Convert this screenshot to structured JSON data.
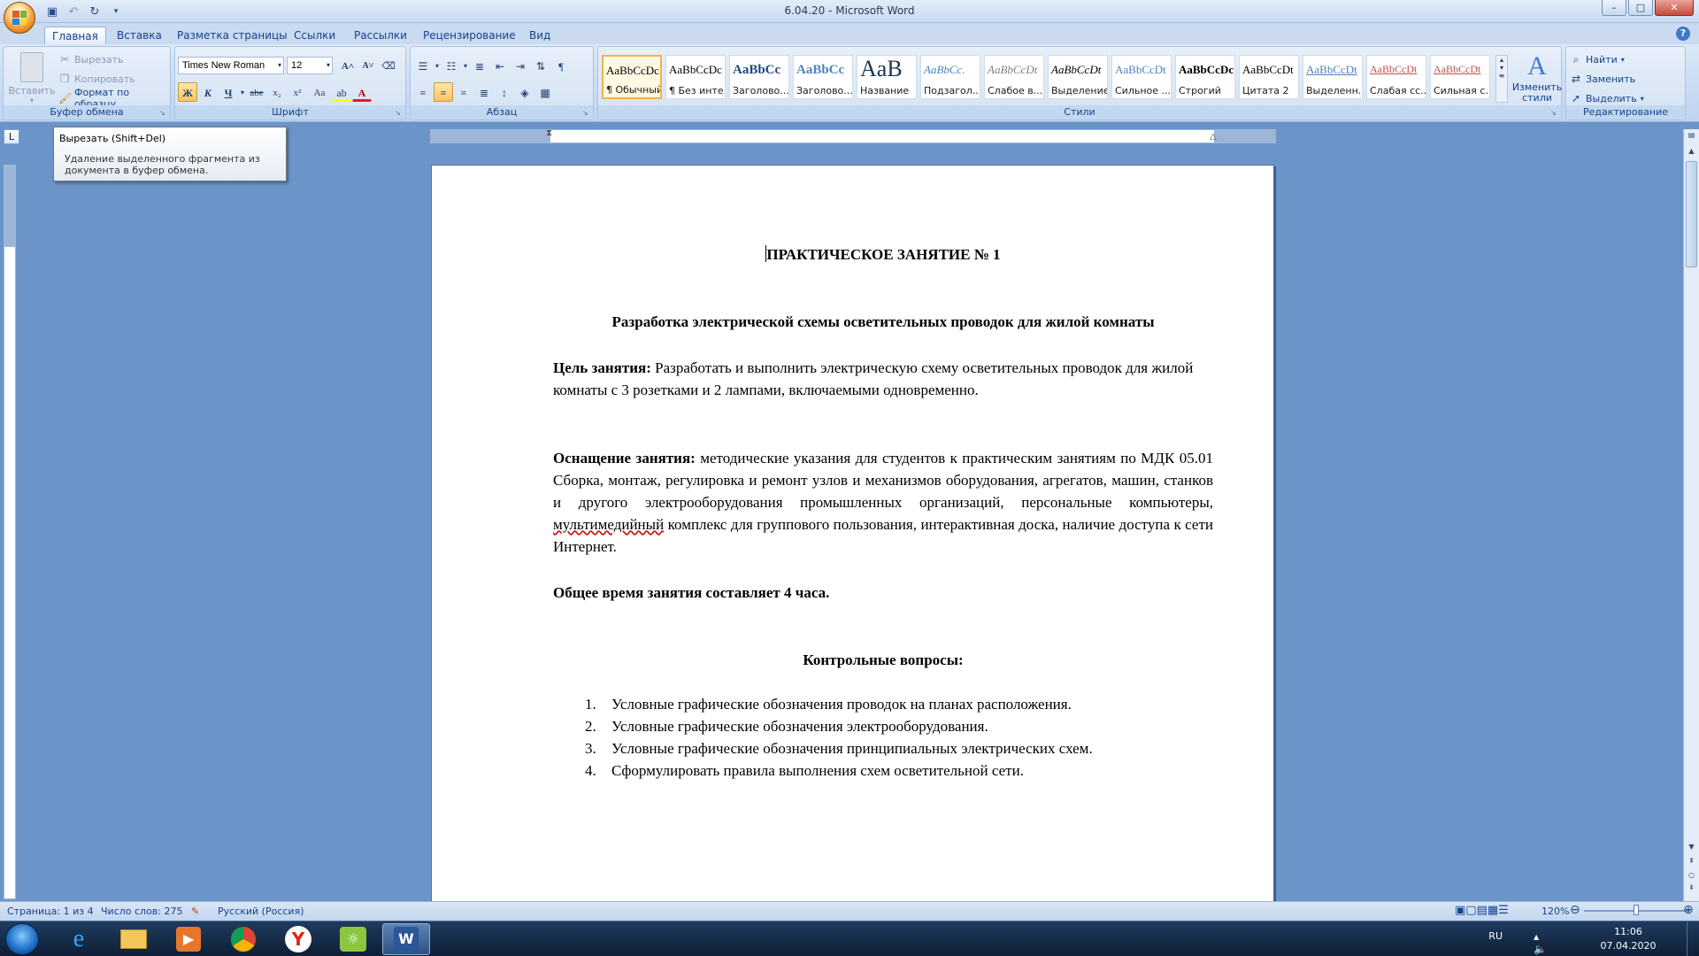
{
  "window": {
    "title": "6.04.20 - Microsoft Word",
    "controls": {
      "minimize": "–",
      "maximize": "□",
      "close": "✕"
    }
  },
  "tabs": [
    {
      "label": "Главная",
      "active": true
    },
    {
      "label": "Вставка"
    },
    {
      "label": "Разметка страницы"
    },
    {
      "label": "Ссылки"
    },
    {
      "label": "Рассылки"
    },
    {
      "label": "Рецензирование"
    },
    {
      "label": "Вид"
    }
  ],
  "ribbon": {
    "clipboard": {
      "group_label": "Буфер обмена",
      "paste": "Вставить",
      "cut": "Вырезать",
      "copy": "Копировать",
      "format_painter": "Формат по образцу"
    },
    "font": {
      "group_label": "Шрифт",
      "font_name": "Times New Roman",
      "font_size": "12",
      "bold": "Ж",
      "italic": "К",
      "underline": "Ч",
      "strike": "abe",
      "subscript": "x₂",
      "superscript": "x²",
      "case": "Aa",
      "grow": "A˄",
      "shrink": "A˅"
    },
    "paragraph": {
      "group_label": "Абзац"
    },
    "styles": {
      "group_label": "Стили",
      "items": [
        {
          "preview": "AaBbCcDc",
          "name": "¶ Обычный",
          "selected": true,
          "color": "#000000"
        },
        {
          "preview": "AaBbCcDc",
          "name": "¶ Без инте...",
          "color": "#000000"
        },
        {
          "preview": "AaBbCc",
          "name": "Заголово...",
          "color": "#1f497d"
        },
        {
          "preview": "AaBbCc",
          "name": "Заголово...",
          "color": "#4f81bd"
        },
        {
          "preview": "AaB",
          "name": "Название",
          "color": "#17365d"
        },
        {
          "preview": "AaBbCc.",
          "name": "Подзагол...",
          "color": "#4f81bd"
        },
        {
          "preview": "AaBbCcDt",
          "name": "Слабое в...",
          "color": "#808080"
        },
        {
          "preview": "AaBbCcDt",
          "name": "Выделение",
          "color": "#000000"
        },
        {
          "preview": "AaBbCcDt",
          "name": "Сильное ...",
          "color": "#4f81bd"
        },
        {
          "preview": "AaBbCcDc",
          "name": "Строгий",
          "color": "#000000"
        },
        {
          "preview": "AaBbCcDt",
          "name": "Цитата 2",
          "color": "#000000"
        },
        {
          "preview": "AaBbCcDt",
          "name": "Выделенн...",
          "color": "#4f81bd"
        },
        {
          "preview": "AaBbCcDt",
          "name": "Слабая сс...",
          "color": "#c0504d"
        },
        {
          "preview": "AaBbCcDt",
          "name": "Сильная с...",
          "color": "#c0504d"
        }
      ],
      "change_styles": "Изменить стили"
    },
    "editing": {
      "group_label": "Редактирование",
      "find": "Найти",
      "replace": "Заменить",
      "select": "Выделить"
    }
  },
  "tooltip": {
    "title": "Вырезать (Shift+Del)",
    "body": "Удаление выделенного фрагмента из документа в буфер обмена."
  },
  "document": {
    "heading": "ПРАКТИЧЕСКОЕ ЗАНЯТИЕ № 1",
    "subheading": "Разработка электрической схемы осветительных проводок для жилой  комнаты",
    "goal_label": "Цель занятия:",
    "goal_text": "  Разработать и выполнить электрическую схему осветительных проводок для жилой  комнаты с 3 розетками и  2 лампами, включаемыми одновременно.",
    "equip_label": "Оснащение занятия:",
    "equip_text_1": " методические указания для студентов к практическим занятиям по МДК 05.01 Сборка, монтаж, регулировка и ремонт узлов и механизмов оборудования, агрегатов, машин, станков и другого электрооборудования промышленных организаций, персональные компьютеры, ",
    "equip_misspelled": "мультимедийный",
    "equip_text_2": " комплекс для группового пользования, интерактивная доска, наличие доступа к сети Интернет.",
    "time_text": "Общее время занятия составляет 4 часа.",
    "questions_title": "Контрольные вопросы:",
    "questions": [
      {
        "n": "1.",
        "text": "Условные графические обозначения проводок на планах расположения."
      },
      {
        "n": "2.",
        "text": "Условные графические обозначения электрооборудования."
      },
      {
        "n": "3.",
        "text": "Условные графические обозначения принципиальных электрических схем."
      },
      {
        "n": "4.",
        "text": "Сформулировать правила выполнения схем осветительной сети."
      }
    ]
  },
  "statusbar": {
    "page": "Страница: 1 из 4",
    "words": "Число слов: 275",
    "language": "Русский (Россия)",
    "zoom": "120%"
  },
  "taskbar": {
    "lang": "RU",
    "time": "11:06",
    "date": "07.04.2020"
  }
}
